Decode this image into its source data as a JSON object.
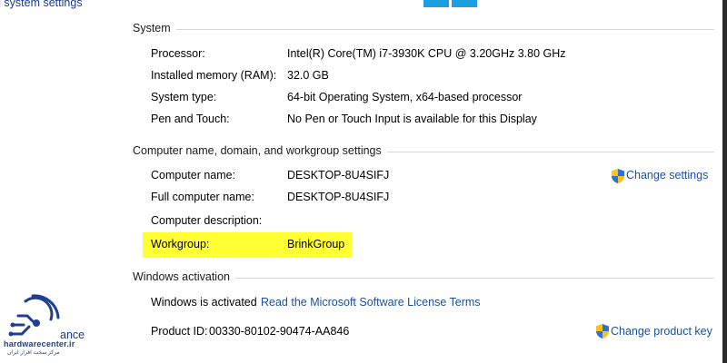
{
  "sidebar": {
    "top_link": "d system settings",
    "bottom_partial": "ance",
    "logo_text": "hardwarecenter.ir",
    "logo_subtext": "مرکز سخت افزار ایران"
  },
  "system": {
    "title": "System",
    "rows": [
      {
        "label": "Processor:",
        "value": "Intel(R) Core(TM) i7-3930K CPU @ 3.20GHz   3.80 GHz"
      },
      {
        "label": "Installed memory (RAM):",
        "value": "32.0 GB"
      },
      {
        "label": "System type:",
        "value": "64-bit Operating System, x64-based processor"
      },
      {
        "label": "Pen and Touch:",
        "value": "No Pen or Touch Input is available for this Display"
      }
    ]
  },
  "computer": {
    "title": "Computer name, domain, and workgroup settings",
    "change_settings": "Change settings",
    "rows": [
      {
        "label": "Computer name:",
        "value": "DESKTOP-8U4SIFJ"
      },
      {
        "label": "Full computer name:",
        "value": "DESKTOP-8U4SIFJ"
      },
      {
        "label": "Computer description:",
        "value": ""
      },
      {
        "label": "Workgroup:",
        "value": "BrinkGroup"
      }
    ]
  },
  "activation": {
    "title": "Windows activation",
    "status": "Windows is activated",
    "license_link": "Read the Microsoft Software License Terms",
    "product_id_label": "Product ID:",
    "product_id": "00330-80102-90474-AA846",
    "change_key": "Change product key"
  },
  "colors": {
    "highlight": "#ffff33",
    "link": "#1a4f9c",
    "windows_blue": "#1a9fe0"
  }
}
